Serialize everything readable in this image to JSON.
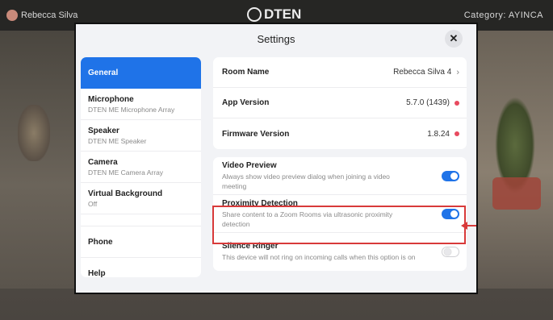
{
  "topbar": {
    "user_name": "Rebecca Silva",
    "logo_text": "DTEN",
    "right_text": "Category: AYINCA"
  },
  "dialog": {
    "title": "Settings",
    "close_label": "✕"
  },
  "sidebar": {
    "items": [
      {
        "label": "General",
        "sub": ""
      },
      {
        "label": "Microphone",
        "sub": "DTEN ME Microphone Array"
      },
      {
        "label": "Speaker",
        "sub": "DTEN ME Speaker"
      },
      {
        "label": "Camera",
        "sub": "DTEN ME Camera Array"
      },
      {
        "label": "Virtual Background",
        "sub": "Off"
      },
      {
        "label": "Phone",
        "sub": ""
      },
      {
        "label": "Help",
        "sub": ""
      }
    ],
    "active_index": 0
  },
  "info": {
    "room_name_label": "Room Name",
    "room_name_value": "Rebecca Silva 4",
    "app_version_label": "App Version",
    "app_version_value": "5.7.0 (1439)",
    "firmware_label": "Firmware Version",
    "firmware_value": "1.8.24"
  },
  "toggles": [
    {
      "title": "Video Preview",
      "desc": "Always show video preview dialog when joining a video meeting",
      "on": true
    },
    {
      "title": "Proximity Detection",
      "desc": "Share content to a Zoom Rooms via ultrasonic proximity detection",
      "on": true
    },
    {
      "title": "Silence Ringer",
      "desc": "This device will not ring on incoming calls when this option is on",
      "on": false
    }
  ],
  "colors": {
    "accent": "#1f73e8",
    "alert_dot": "#e84a5f",
    "highlight": "#d83a3a"
  }
}
